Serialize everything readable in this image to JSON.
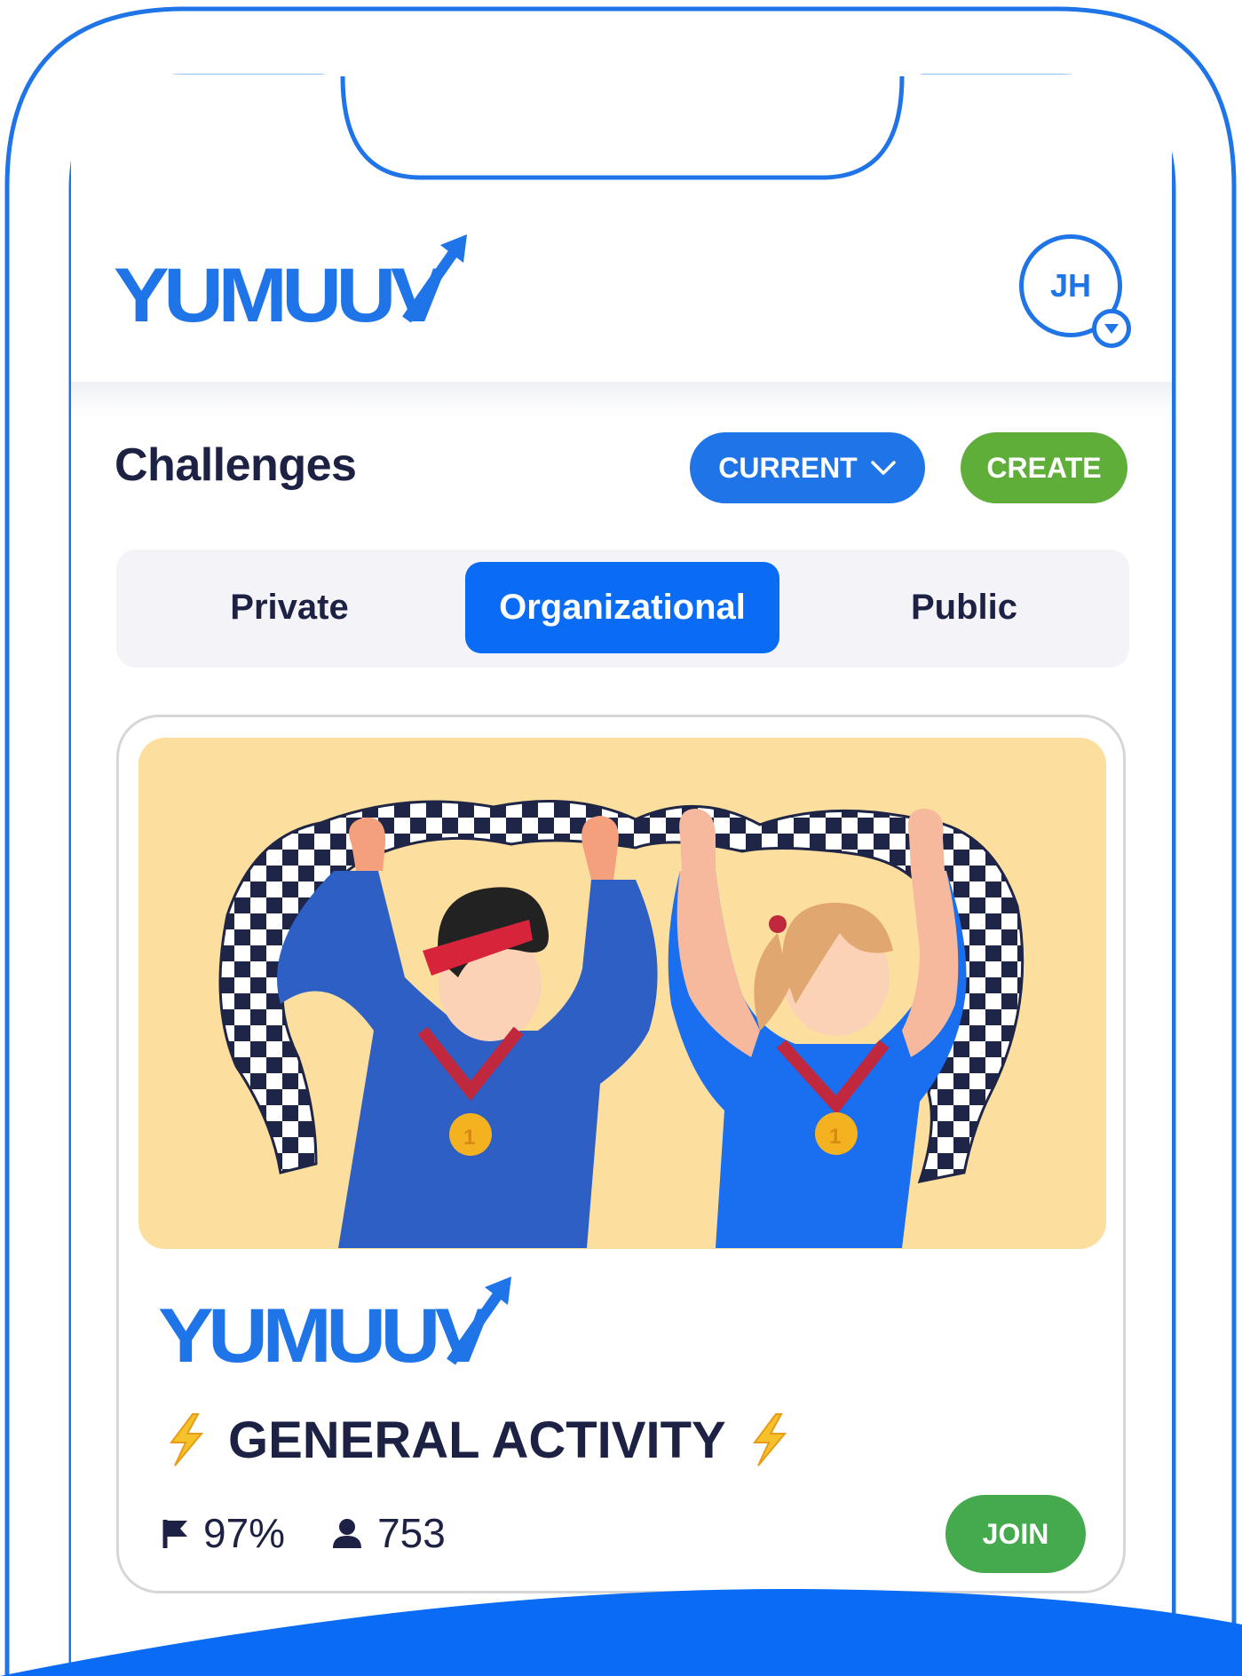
{
  "colors": {
    "brand_blue": "#1f74e8",
    "active_tab_blue": "#0a6cf5",
    "create_green": "#5fae3a",
    "join_green": "#45a94d",
    "text_dark": "#1d2244",
    "illustration_bg": "#fcdf9e"
  },
  "header": {
    "logo_text": "YUMUUV",
    "avatar_initials": "JH",
    "avatar_icon": "chevron-down-icon"
  },
  "challenges": {
    "title": "Challenges",
    "filter_label": "CURRENT",
    "create_label": "CREATE",
    "tabs": [
      {
        "label": "Private",
        "active": false
      },
      {
        "label": "Organizational",
        "active": true
      },
      {
        "label": "Public",
        "active": false
      }
    ]
  },
  "card": {
    "illustration": "two athletes with medals holding a checkered flag",
    "brand_logo_text": "YUMUUV",
    "title": "GENERAL ACTIVITY",
    "title_icon": "lightning-icon",
    "progress": "97%",
    "participants": "753",
    "join_label": "JOIN"
  }
}
